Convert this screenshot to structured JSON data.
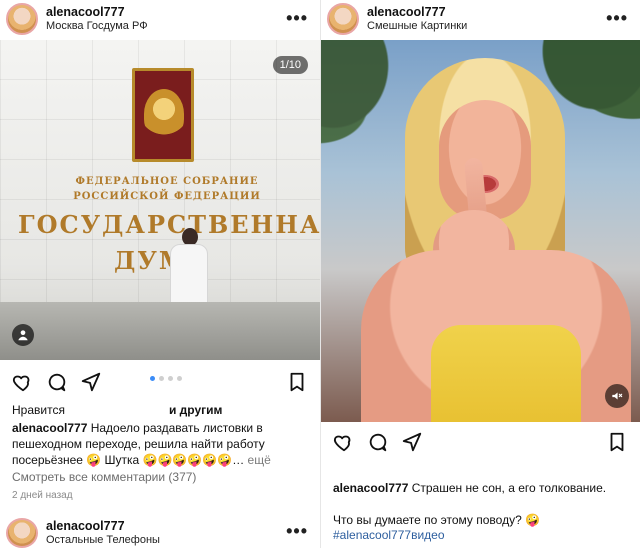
{
  "left_post": {
    "username": "alenacool777",
    "location": "Москва Госдума РФ",
    "more_glyph": "•••",
    "image_counter": "1/10",
    "sign": {
      "line1": "ФЕДЕРАЛЬНОЕ СОБРАНИЕ",
      "line2": "РОССИЙСКОЙ ФЕДЕРАЦИИ",
      "line3": "ГОСУДАРСТВЕННАЯ",
      "line4": "ДУМА"
    },
    "likes_prefix": "Нравится",
    "likes_other": "и другим",
    "caption_user": "alenacool777",
    "caption_text": "Надоело раздавать листовки в пешеходном переходе, решила найти работу посерьёзнее 🤪 Шутка 🤪🤪🤪🤪🤪🤪…",
    "caption_more": "ещё",
    "view_comments": "Смотреть все комментарии (377)",
    "time": "2 дней назад"
  },
  "next_post": {
    "username": "alenacool777",
    "location": "Остальные Телефоны",
    "more_glyph": "•••"
  },
  "right_post": {
    "username": "alenacool777",
    "location": "Смешные Картинки",
    "more_glyph": "•••",
    "caption_user": "alenacool777",
    "caption_text": "Страшен не сон, а его толкование.",
    "question": "Что вы думаете по этому поводу? 🤪",
    "hashtag": "#alenacool777видео"
  },
  "icons": {
    "like": "heart-icon",
    "comment": "comment-icon",
    "share": "send-icon",
    "save": "bookmark-icon",
    "tag": "user-tag-icon",
    "mute": "mute-icon"
  },
  "carousel": {
    "active_index": 1,
    "total_dots": 4
  },
  "colors": {
    "link": "#2d5e9e",
    "muted": "#6d6d6d",
    "carousel_active": "#3b8cf7"
  }
}
